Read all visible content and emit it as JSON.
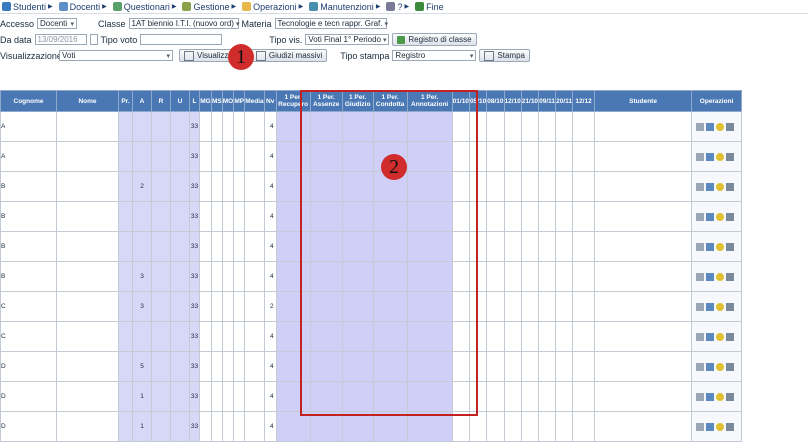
{
  "menu": [
    {
      "label": "Studenti",
      "icon": "students-icon",
      "color": "#3b7bbf"
    },
    {
      "label": "Docenti",
      "icon": "teachers-icon",
      "color": "#5c8fc7"
    },
    {
      "label": "Questionari",
      "icon": "survey-icon",
      "color": "#5aa06a"
    },
    {
      "label": "Gestione",
      "icon": "management-icon",
      "color": "#8aa34a"
    },
    {
      "label": "Operazioni",
      "icon": "operations-icon",
      "color": "#e6b84a"
    },
    {
      "label": "Manutenzioni",
      "icon": "maintenance-icon",
      "color": "#4a8fb0"
    },
    {
      "label": "?",
      "icon": "help-icon",
      "color": "#7a7a9a"
    },
    {
      "label": "Fine",
      "icon": "exit-icon",
      "color": "#3c8a3c"
    }
  ],
  "filters": {
    "accesso_label": "Accesso",
    "accesso_value": "Docenti",
    "classe_label": "Classe",
    "classe_value": "1AT biennio I.T.I. (nuovo ord)",
    "materia_label": "Materia",
    "materia_value": "Tecnologie e tecn rappr. Graf.",
    "da_data_label": "Da data",
    "da_data_value": "13/09/2016",
    "tipo_voto_label": "Tipo voto",
    "tipo_voto_value": "",
    "tipo_vis_label": "Tipo vis.",
    "tipo_vis_value": "Voti Final 1° Periodo",
    "registro_button": "Registro di classe",
    "visualizzazione_label": "Visualizzazione",
    "visualizzazione_value": "Voti",
    "visualizza_button": "Visualizza",
    "giudizi_button": "Giudizi massivi",
    "tipo_stampa_label": "Tipo stampa",
    "tipo_stampa_value": "Registro",
    "stampa_button": "Stampa"
  },
  "callouts": {
    "one": "1",
    "two": "2"
  },
  "table": {
    "headers": {
      "cognome": "Cognome",
      "nome": "Nome",
      "pr": "Pr.",
      "a": "A",
      "r": "R",
      "u": "U",
      "l": "L",
      "mg": "MG",
      "ms": "MS",
      "mo": "MO",
      "mp": "MP",
      "media": "Media",
      "nv": "Nv",
      "recupero": "1 Per. Recupero",
      "assenze": "1 Per. Assenze",
      "giudizio": "1 Per. Giudizio",
      "condotta": "1 Per. Condotta",
      "annotazioni": "1 Per. Annotazioni",
      "d1": "01/10",
      "d2": "05/10",
      "d3": "08/10",
      "d4": "12/10",
      "d5": "21/10",
      "d6": "09/11",
      "d7": "20/11",
      "d8": "12/12",
      "studente": "Studente",
      "operazioni": "Operazioni"
    },
    "rows": [
      {
        "cognome": "A",
        "a": "",
        "l": "33",
        "nv": "4"
      },
      {
        "cognome": "A",
        "a": "",
        "l": "33",
        "nv": "4"
      },
      {
        "cognome": "B",
        "a": "2",
        "l": "33",
        "nv": "4"
      },
      {
        "cognome": "B",
        "a": "",
        "l": "33",
        "nv": "4"
      },
      {
        "cognome": "B",
        "a": "",
        "l": "33",
        "nv": "4"
      },
      {
        "cognome": "B",
        "a": "3",
        "l": "33",
        "nv": "4"
      },
      {
        "cognome": "C",
        "a": "3",
        "l": "33",
        "nv": "2"
      },
      {
        "cognome": "C",
        "a": "",
        "l": "33",
        "nv": "4"
      },
      {
        "cognome": "D",
        "a": "5",
        "l": "33",
        "nv": "4"
      },
      {
        "cognome": "D",
        "a": "1",
        "l": "33",
        "nv": "4"
      },
      {
        "cognome": "D",
        "a": "1",
        "l": "33",
        "nv": "4"
      }
    ]
  }
}
